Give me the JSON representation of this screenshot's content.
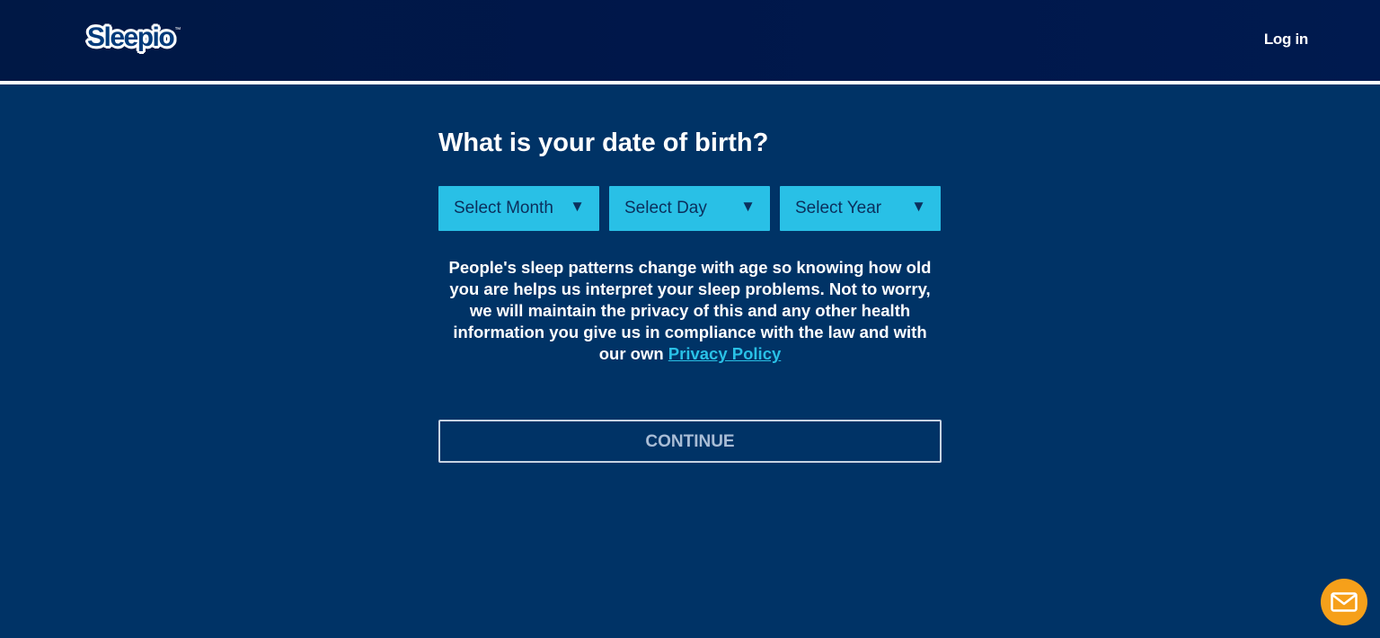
{
  "header": {
    "logo_text": "Sleepio",
    "logo_tm": "™",
    "login_label": "Log in"
  },
  "main": {
    "question": "What is your date of birth?",
    "selects": [
      {
        "label": "Select Month"
      },
      {
        "label": "Select Day"
      },
      {
        "label": "Select Year"
      }
    ],
    "explanation": "People's sleep patterns change with age so knowing how old you are helps us interpret your sleep problems. Not to worry, we will maintain the privacy of this and any other health information you give us in compliance with the law and with our own",
    "privacy_link": "Privacy Policy",
    "continue_label": "CONTINUE"
  },
  "chat": {
    "icon": "mail-icon"
  },
  "colors": {
    "header_bg": "#001845",
    "page_bg": "#003366",
    "accent": "#29c0e6",
    "chat": "#f6a01a"
  }
}
